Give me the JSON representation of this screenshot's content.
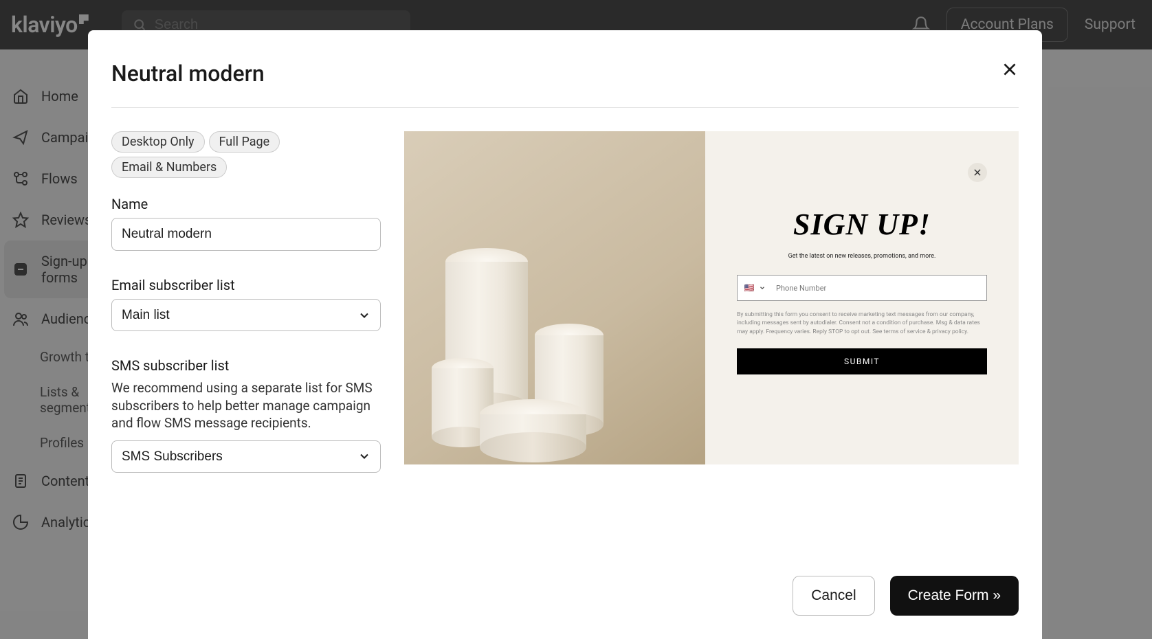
{
  "topbar": {
    "logo": "klaviyo",
    "search_placeholder": "Search",
    "account_plans": "Account Plans",
    "support": "Support"
  },
  "sidebar": {
    "items": [
      {
        "label": "Home"
      },
      {
        "label": "Campaigns"
      },
      {
        "label": "Flows"
      },
      {
        "label": "Reviews"
      },
      {
        "label": "Sign-up forms"
      },
      {
        "label": "Audience"
      },
      {
        "label": "Content"
      },
      {
        "label": "Analytics"
      }
    ],
    "audience_sub": [
      {
        "label": "Growth tools"
      },
      {
        "label": "Lists & segments"
      },
      {
        "label": "Profiles"
      }
    ]
  },
  "modal": {
    "title": "Neutral modern",
    "tags": [
      "Desktop Only",
      "Full Page",
      "Email & Numbers"
    ],
    "name_label": "Name",
    "name_value": "Neutral modern",
    "email_list_label": "Email subscriber list",
    "email_list_value": "Main list",
    "sms_list_label": "SMS subscriber list",
    "sms_list_desc": "We recommend using a separate list for SMS subscribers to help better manage campaign and flow SMS message recipients.",
    "sms_list_value": "SMS Subscribers",
    "cancel": "Cancel",
    "create": "Create Form »"
  },
  "preview": {
    "title": "SIGN UP!",
    "subtitle": "Get the latest on new releases, promotions, and more.",
    "phone_placeholder": "Phone Number",
    "flag": "🇺🇸",
    "disclaimer": "By submitting this form you consent to receive marketing text messages from our company, including messages sent by autodialer. Consent not a condition of purchase. Msg & data rates may apply. Frequency varies. Reply STOP to opt out. See terms of service & privacy policy.",
    "submit": "SUBMIT"
  }
}
